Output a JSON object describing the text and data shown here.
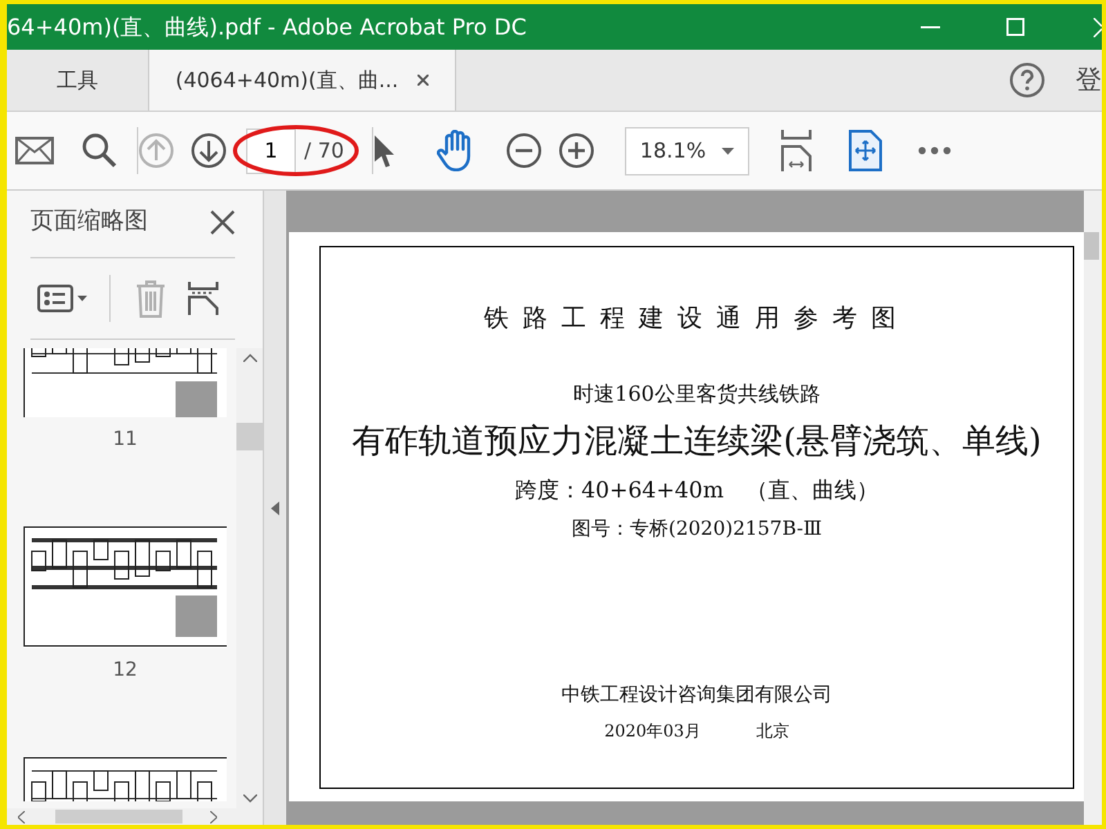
{
  "window": {
    "title": "64+40m)(直、曲线).pdf - Adobe Acrobat Pro DC"
  },
  "tabs": [
    {
      "label": "工具",
      "selected": false
    },
    {
      "label": "(4064+40m)(直、曲...",
      "selected": true
    }
  ],
  "account": {
    "label": "登"
  },
  "toolbar": {
    "prev_page": {
      "disabled": true
    },
    "next_page": {
      "disabled": false
    },
    "page_field": {
      "value": "1"
    },
    "page_total": "/ 70",
    "zoom": {
      "value": "18.1%"
    }
  },
  "sidebar": {
    "title": "页面缩略图",
    "delete": {
      "disabled": true
    },
    "thumbnails": [
      {
        "kind": "labeled",
        "label": "11"
      },
      {
        "kind": "labeled",
        "label": "12"
      },
      {
        "kind": "cut"
      }
    ]
  },
  "document": {
    "lines": [
      {
        "kind": "heading",
        "text": "铁路工程建设通用参考图"
      },
      {
        "kind": "subtitle",
        "text": "时速160公里客货共线铁路"
      },
      {
        "kind": "title",
        "text": "有砟轨道预应力混凝土连续梁(悬臂浇筑、单线)"
      },
      {
        "kind": "line",
        "text": "跨度：40+64+40m　（直、曲线）"
      },
      {
        "kind": "small",
        "text": "图号：专桥(2020)2157B-Ⅲ"
      }
    ],
    "footer": {
      "organization": "中铁工程设计咨询集团有限公司",
      "date": "2020年03月",
      "place": "北京"
    }
  }
}
